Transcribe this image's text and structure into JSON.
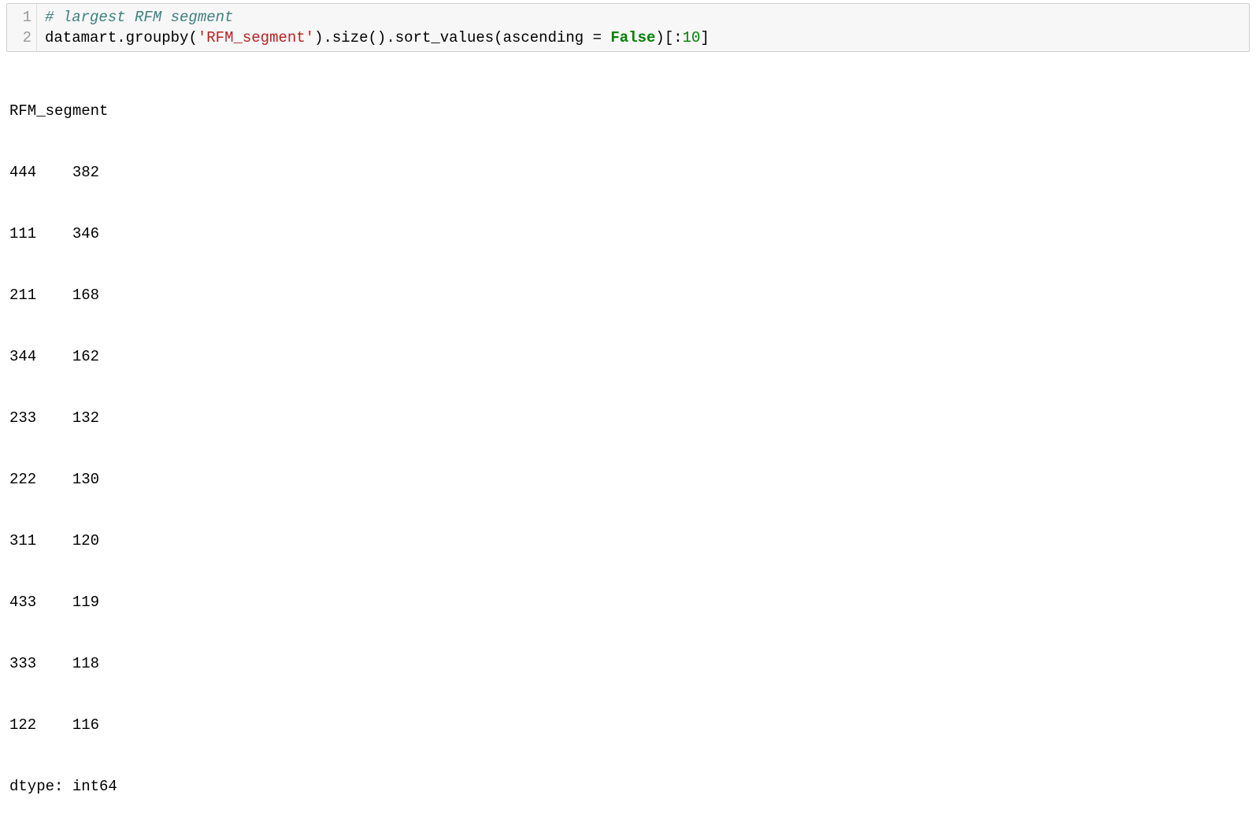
{
  "code": {
    "line_numbers": [
      "1",
      "2"
    ],
    "line1_comment": "# largest RFM segment",
    "line2_parts": {
      "p1": "datamart",
      "dot1": ".",
      "groupby": "groupby",
      "open1": "(",
      "str": "'RFM_segment'",
      "close1": ")",
      "dot2": ".",
      "size": "size",
      "open2": "(",
      "close2": ")",
      "dot3": ".",
      "sort_values": "sort_values",
      "open3": "(",
      "ascending_arg": "ascending ",
      "eq": "= ",
      "false_kw": "False",
      "close3": ")",
      "slice_open": "[:",
      "slice_num": "10",
      "slice_close": "]"
    }
  },
  "output": {
    "header": "RFM_segment",
    "rows": [
      {
        "seg": "444",
        "val": "382"
      },
      {
        "seg": "111",
        "val": "346"
      },
      {
        "seg": "211",
        "val": "168"
      },
      {
        "seg": "344",
        "val": "162"
      },
      {
        "seg": "233",
        "val": "132"
      },
      {
        "seg": "222",
        "val": "130"
      },
      {
        "seg": "311",
        "val": "120"
      },
      {
        "seg": "433",
        "val": "119"
      },
      {
        "seg": "333",
        "val": "118"
      },
      {
        "seg": "122",
        "val": "116"
      }
    ],
    "dtype": "dtype: int64"
  }
}
